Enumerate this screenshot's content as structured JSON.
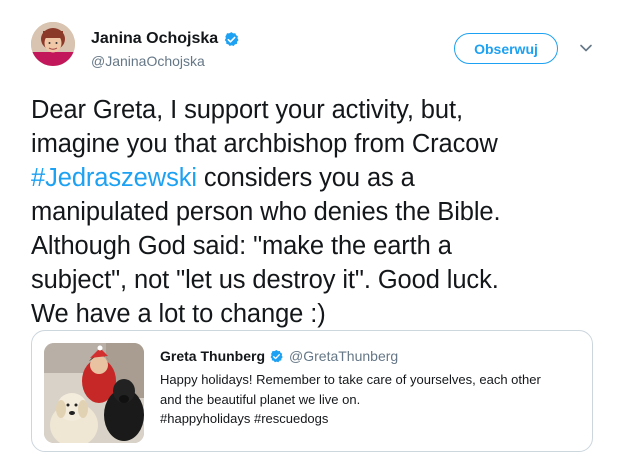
{
  "author": {
    "name": "Janina Ochojska",
    "handle": "@JaninaOchojska"
  },
  "follow_button": {
    "label": "Obserwuj"
  },
  "tweet": {
    "text_before_hashtag": "Dear Greta, I support your activity, but,\nimagine you that archbishop from Cracow\n",
    "hashtag": "#Jedraszewski",
    "text_after_hashtag": " considers you as a\nmanipulated person who denies the Bible.\nAlthough God said: \"make the earth a\nsubject\", not \"let us destroy it\". Good luck.\nWe have a lot to change :)"
  },
  "quoted_tweet": {
    "name": "Greta Thunberg",
    "handle": "@GretaThunberg",
    "line1": "Happy holidays! Remember to take care of yourselves, each other",
    "line2": "and the beautiful planet we live on.",
    "line3": "#happyholidays #rescuedogs"
  },
  "colors": {
    "accent": "#1da1f2",
    "text": "#14171a",
    "muted": "#657786",
    "border": "#ccd6dd"
  },
  "icons": {
    "verified": "verified-badge-icon",
    "caret": "chevron-down-icon"
  }
}
